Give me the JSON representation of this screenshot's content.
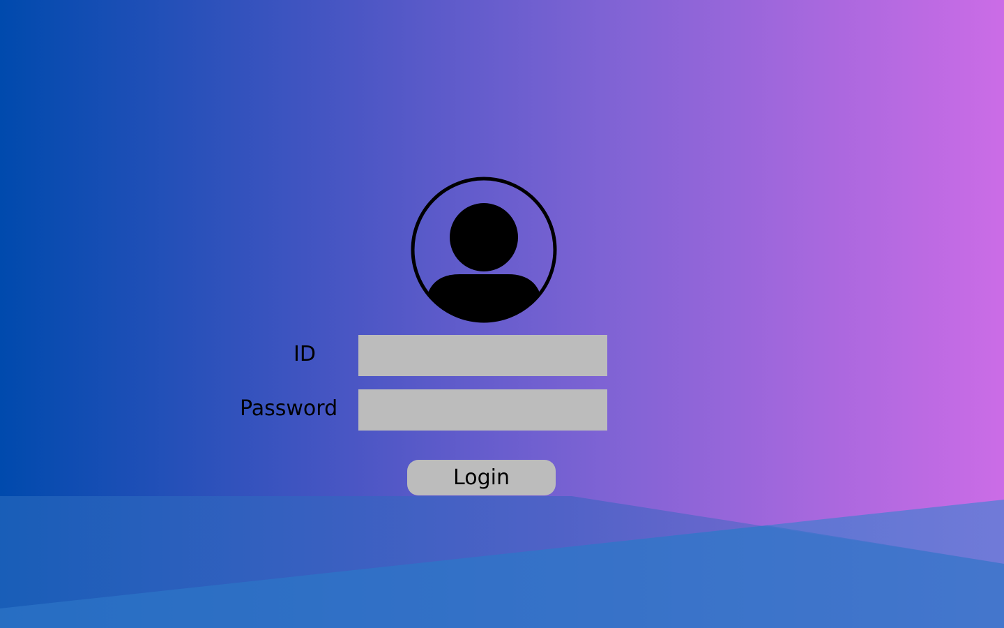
{
  "form": {
    "id_label": "ID",
    "password_label": "Password",
    "id_value": "",
    "password_value": "",
    "login_label": "Login"
  },
  "icons": {
    "avatar": "user-avatar-icon"
  },
  "colors": {
    "gradient_left": "#004aad",
    "gradient_right": "#cb6ce6",
    "field_fill": "#bcbcbc",
    "button_fill": "#bcbcbc",
    "text": "#000000"
  }
}
